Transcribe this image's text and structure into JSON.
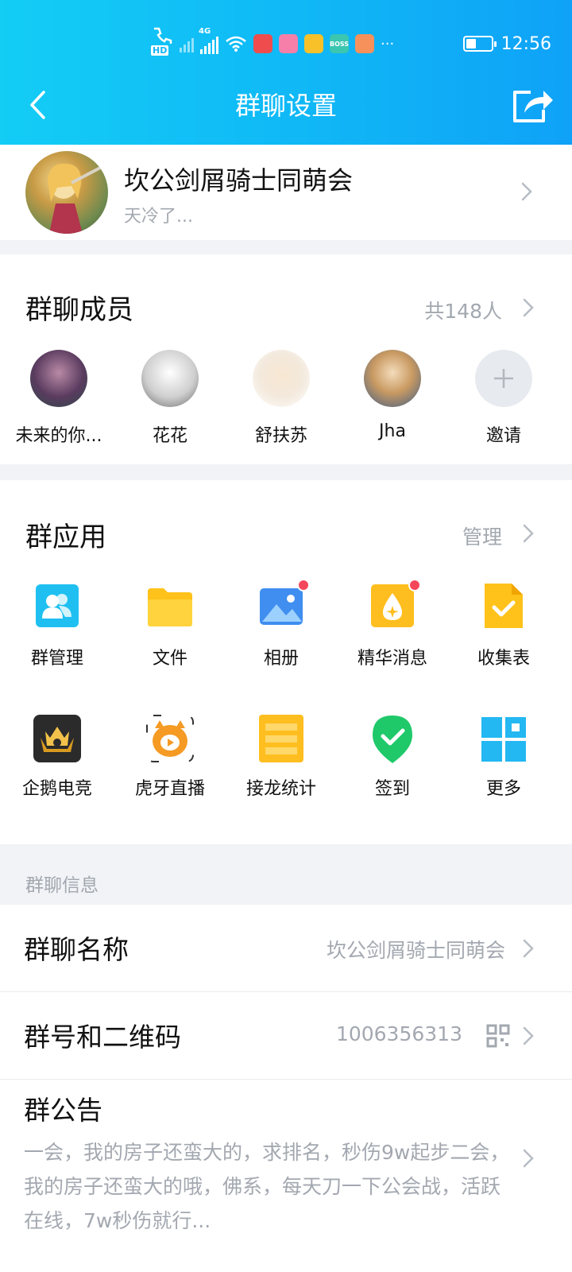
{
  "status_bar": {
    "time": "12:56",
    "carrier_hd": "HD",
    "network_4g": "4G",
    "boss_badge": "BOSS",
    "more_dots": "···",
    "battery_level": 0.4
  },
  "navbar": {
    "title": "群聊设置"
  },
  "group": {
    "name": "坎公剑屑骑士同萌会",
    "subtitle": "天冷了..."
  },
  "members_section": {
    "title": "群聊成员",
    "count": "共148人",
    "members": [
      {
        "name": "未来的你...",
        "color": "#5a3b5f"
      },
      {
        "name": "花花",
        "color": "#d9d9d9"
      },
      {
        "name": "舒扶苏",
        "color": "#f3e9dc"
      },
      {
        "name": "Jha",
        "color": "#d8e7f2"
      }
    ],
    "invite_label": "邀请"
  },
  "apps_section": {
    "title": "群应用",
    "manage_label": "管理",
    "apps": [
      {
        "label": "群管理",
        "icon": "group-manage-icon"
      },
      {
        "label": "文件",
        "icon": "folder-icon"
      },
      {
        "label": "相册",
        "icon": "album-icon"
      },
      {
        "label": "精华消息",
        "icon": "essence-icon"
      },
      {
        "label": "收集表",
        "icon": "form-icon"
      },
      {
        "label": "企鹅电竞",
        "icon": "esports-icon"
      },
      {
        "label": "虎牙直播",
        "icon": "huya-icon"
      },
      {
        "label": "接龙统计",
        "icon": "relay-icon"
      },
      {
        "label": "签到",
        "icon": "checkin-icon"
      },
      {
        "label": "更多",
        "icon": "more-apps-icon"
      }
    ]
  },
  "info_section": {
    "label": "群聊信息",
    "name_row": {
      "title": "群聊名称",
      "value": "坎公剑屑骑士同萌会"
    },
    "number_row": {
      "title": "群号和二维码",
      "value": "1006356313"
    },
    "notice": {
      "title": "群公告",
      "text": "一会，我的房子还蛮大的，求排名，秒伤9w起步二会，我的房子还蛮大的哦，佛系，每天刀一下公会战，活跃在线，7w秒伤就行..."
    }
  },
  "colors": {
    "header_start": "#13cdf5",
    "header_end": "#0fa2f7",
    "secondary_text": "#a3a8b0",
    "red_dot": "#f5475b"
  }
}
